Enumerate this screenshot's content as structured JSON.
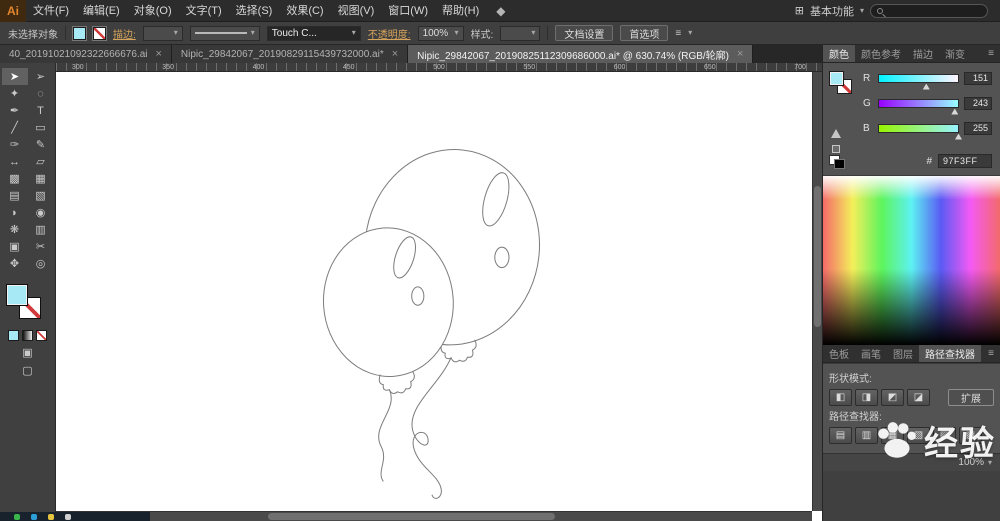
{
  "menubar": {
    "logo": "Ai",
    "items": [
      "文件(F)",
      "编辑(E)",
      "对象(O)",
      "文字(T)",
      "选择(S)",
      "效果(C)",
      "视图(V)",
      "窗口(W)",
      "帮助(H)"
    ],
    "workspace": "基本功能"
  },
  "controlbar": {
    "no_selection": "未选择对象",
    "stroke_label": "描边:",
    "profile": "Touch C...",
    "opacity_label": "不透明度:",
    "opacity_value": "100%",
    "style_label": "样式:",
    "doc_setup": "文档设置",
    "preferences": "首选项"
  },
  "tabs": [
    {
      "label": "40_20191021092322666676.ai"
    },
    {
      "label": "Nipic_29842067_20190829115439732000.ai*"
    },
    {
      "label": "Nipic_29842067_20190825112309686000.ai* @ 630.74% (RGB/轮廓)"
    }
  ],
  "ruler_numbers": [
    "300",
    "350",
    "400",
    "450",
    "500",
    "550",
    "600",
    "650",
    "700"
  ],
  "toolbar": {
    "tools": [
      {
        "name": "selection-tool",
        "glyph": "➤"
      },
      {
        "name": "direct-selection-tool",
        "glyph": "➢"
      },
      {
        "name": "magic-wand-tool",
        "glyph": "✦"
      },
      {
        "name": "lasso-tool",
        "glyph": "◌"
      },
      {
        "name": "pen-tool",
        "glyph": "✒"
      },
      {
        "name": "type-tool",
        "glyph": "T"
      },
      {
        "name": "line-segment-tool",
        "glyph": "╱"
      },
      {
        "name": "rectangle-tool",
        "glyph": "▭"
      },
      {
        "name": "paintbrush-tool",
        "glyph": "✑"
      },
      {
        "name": "pencil-tool",
        "glyph": "✎"
      },
      {
        "name": "width-tool",
        "glyph": "↔"
      },
      {
        "name": "free-transform-tool",
        "glyph": "▱"
      },
      {
        "name": "shape-builder-tool",
        "glyph": "▩"
      },
      {
        "name": "perspective-grid-tool",
        "glyph": "▦"
      },
      {
        "name": "mesh-tool",
        "glyph": "▤"
      },
      {
        "name": "gradient-tool",
        "glyph": "▧"
      },
      {
        "name": "eyedropper-tool",
        "glyph": "◗"
      },
      {
        "name": "blend-tool",
        "glyph": "◉"
      },
      {
        "name": "symbol-sprayer-tool",
        "glyph": "❋"
      },
      {
        "name": "column-graph-tool",
        "glyph": "▥"
      },
      {
        "name": "artboard-tool",
        "glyph": "▣"
      },
      {
        "name": "slice-tool",
        "glyph": "✂"
      },
      {
        "name": "hand-tool",
        "glyph": "✥"
      },
      {
        "name": "zoom-tool",
        "glyph": "◎"
      }
    ]
  },
  "color_panel": {
    "tabs": [
      "颜色",
      "颜色参考",
      "描边",
      "渐变"
    ],
    "channels": [
      {
        "label": "R",
        "value": "151"
      },
      {
        "label": "G",
        "value": "243"
      },
      {
        "label": "B",
        "value": "255"
      }
    ],
    "hex_label": "#",
    "hex": "97F3FF"
  },
  "panels": {
    "tabs": [
      "色板",
      "画笔",
      "图层",
      "路径查找器"
    ],
    "shape_modes_label": "形状模式:",
    "shape_mode_buttons": [
      "◧",
      "◨",
      "◩",
      "◪"
    ],
    "expand": "扩展",
    "pathfinder_label": "路径查找器:",
    "pathfinder_buttons": [
      "▤",
      "▥",
      "▦",
      "▧",
      "▨",
      "▩"
    ],
    "bottom_value": "100%"
  },
  "watermark": {
    "text": "经验"
  },
  "ui": {
    "caret": "▾",
    "close": "×",
    "panel_menu": "≡",
    "workspace_icon": "⊞",
    "mode_normal": "▣",
    "screen_mode": "▢"
  },
  "colors": {
    "fill": "#A7EAF6",
    "accent": "#D7A45C"
  }
}
